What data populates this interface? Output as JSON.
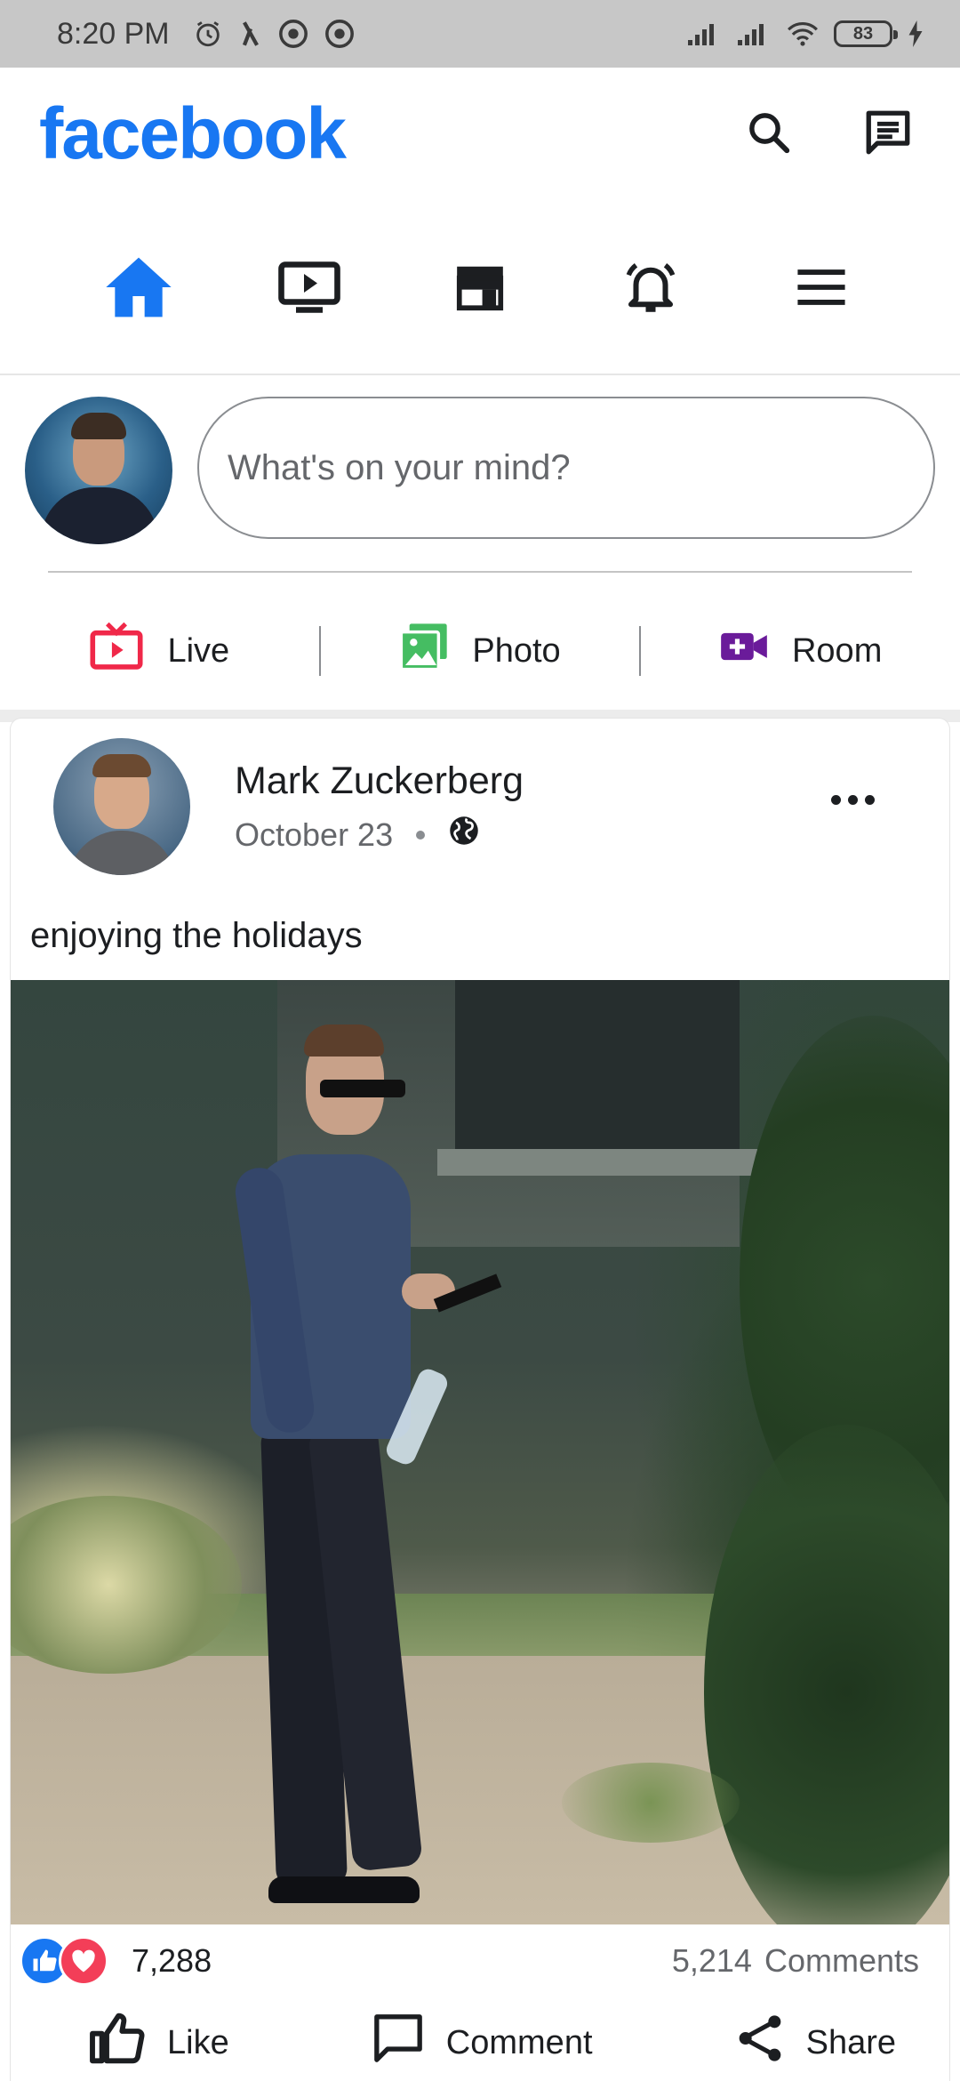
{
  "status_bar": {
    "time": "8:20 PM",
    "battery": "83",
    "icons": [
      "alarm-icon",
      "app-icon",
      "vpn-icon",
      "vpn-icon",
      "signal-icon",
      "signal-icon",
      "wifi-icon",
      "battery-icon",
      "charging-icon"
    ]
  },
  "header": {
    "logo": "facebook",
    "icons": [
      "search-icon",
      "messenger-icon"
    ]
  },
  "nav": {
    "tabs": [
      {
        "name": "home",
        "icon": "home-icon",
        "active": true
      },
      {
        "name": "watch",
        "icon": "video-icon",
        "active": false
      },
      {
        "name": "marketplace",
        "icon": "store-icon",
        "active": false
      },
      {
        "name": "notifications",
        "icon": "bell-icon",
        "active": false
      },
      {
        "name": "menu",
        "icon": "menu-icon",
        "active": false
      }
    ],
    "active_color": "#1877F2"
  },
  "composer": {
    "placeholder": "What's on your mind?",
    "actions": [
      {
        "label": "Live",
        "icon": "live-icon",
        "color": "#F02849"
      },
      {
        "label": "Photo",
        "icon": "photo-icon",
        "color": "#45BD62"
      },
      {
        "label": "Room",
        "icon": "room-icon",
        "color": "#6A1B9A"
      }
    ]
  },
  "post": {
    "author": "Mark Zuckerberg",
    "date": "October 23",
    "privacy_icon": "globe-icon",
    "text": "enjoying the holidays",
    "reactions_count": "7,288",
    "comments_count": "5,214",
    "comments_label": "Comments",
    "actions": [
      {
        "label": "Like",
        "icon": "thumbs-up-icon"
      },
      {
        "label": "Comment",
        "icon": "comment-icon"
      },
      {
        "label": "Share",
        "icon": "share-icon"
      }
    ]
  }
}
